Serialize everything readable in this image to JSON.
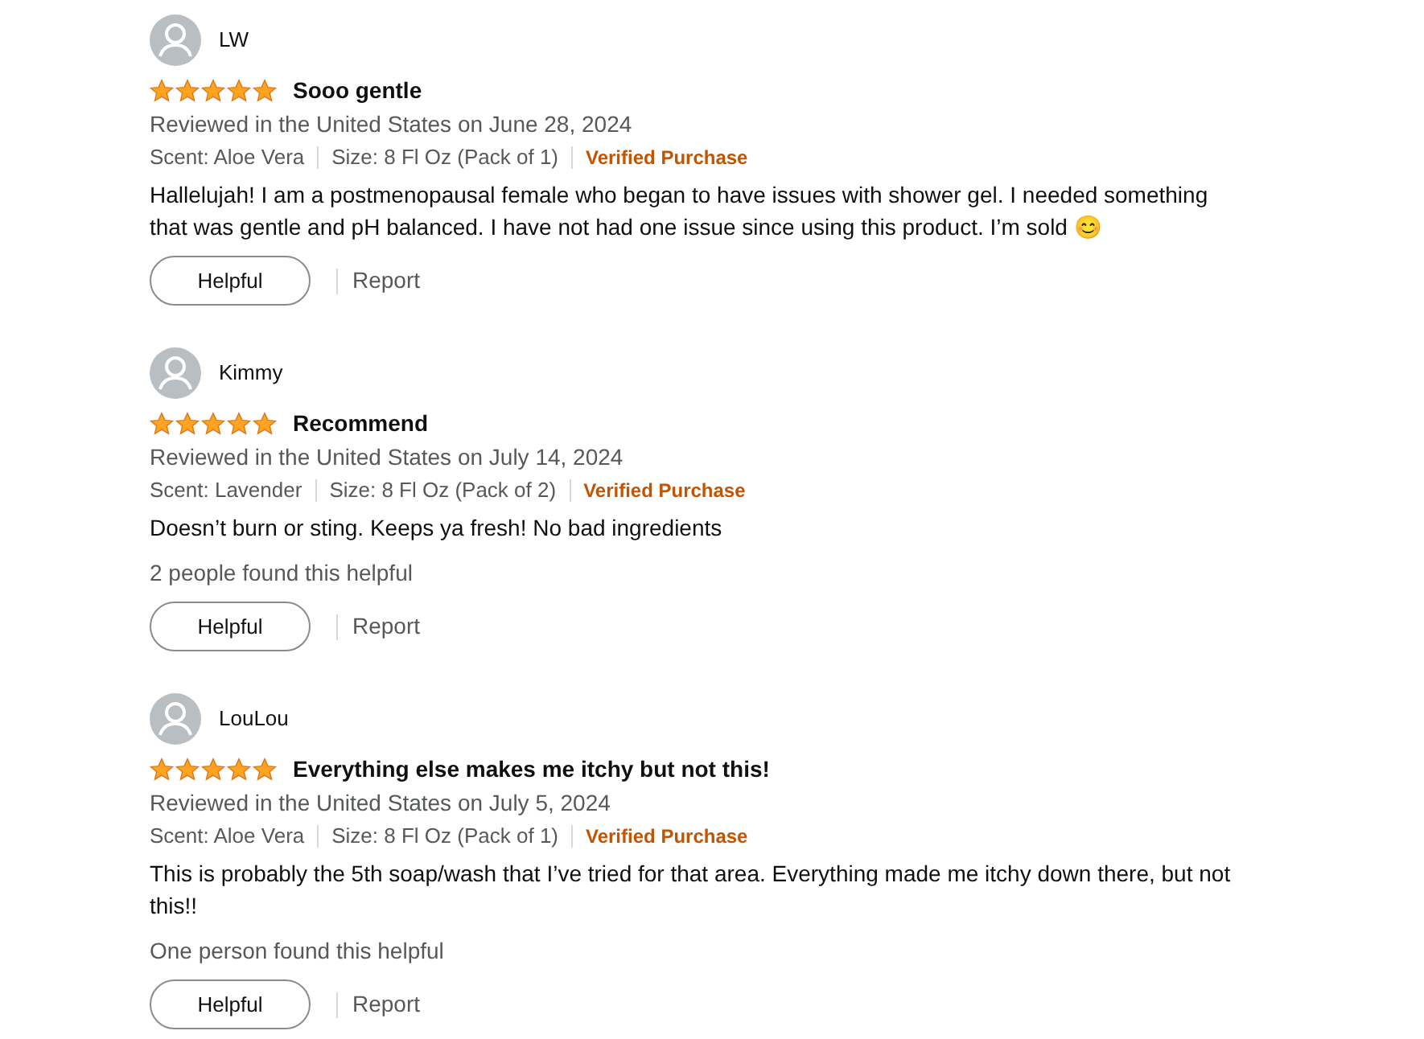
{
  "reviews": [
    {
      "author": "LW",
      "stars": 5,
      "title": "Sooo gentle",
      "date": "Reviewed in the United States on June 28, 2024",
      "scent": "Scent: Aloe Vera",
      "size": "Size: 8 Fl Oz (Pack of 1)",
      "badge": "Verified Purchase",
      "body": "Hallelujah! I am a postmenopausal female who began to have issues with shower gel. I needed something that was gentle and pH balanced. I have not had one issue since using this product. I’m sold 😊",
      "helpful_button": "Helpful",
      "report": "Report"
    },
    {
      "author": "Kimmy",
      "stars": 5,
      "title": "Recommend",
      "date": "Reviewed in the United States on July 14, 2024",
      "scent": "Scent: Lavender",
      "size": "Size: 8 Fl Oz (Pack of 2)",
      "badge": "Verified Purchase",
      "body": "Doesn’t burn or sting. Keeps ya fresh! No bad ingredients",
      "helpful_count": "2 people found this helpful",
      "helpful_button": "Helpful",
      "report": "Report"
    },
    {
      "author": "LouLou",
      "stars": 5,
      "title": "Everything else makes me itchy but not this!",
      "date": "Reviewed in the United States on July 5, 2024",
      "scent": "Scent: Aloe Vera",
      "size": "Size: 8 Fl Oz (Pack of 1)",
      "badge": "Verified Purchase",
      "body": "This is probably the 5th soap/wash that I’ve tried for that area. Everything made me itchy down there, but not this!!",
      "helpful_count": "One person found this helpful",
      "helpful_button": "Helpful",
      "report": "Report"
    }
  ]
}
